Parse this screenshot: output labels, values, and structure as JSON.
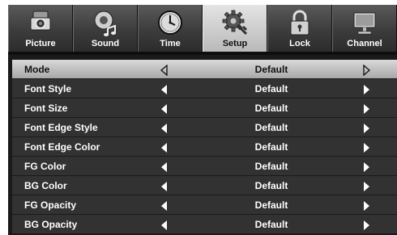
{
  "tabs": [
    {
      "label": "Picture",
      "icon": "picture-camera-icon",
      "active": false
    },
    {
      "label": "Sound",
      "icon": "sound-speaker-icon",
      "active": false
    },
    {
      "label": "Time",
      "icon": "clock-icon",
      "active": false
    },
    {
      "label": "Setup",
      "icon": "setup-gear-icon",
      "active": true
    },
    {
      "label": "Lock",
      "icon": "padlock-icon",
      "active": false
    },
    {
      "label": "Channel",
      "icon": "monitor-icon",
      "active": false
    }
  ],
  "menu": {
    "rows": [
      {
        "label": "Mode",
        "value": "Default",
        "selected": true
      },
      {
        "label": "Font Style",
        "value": "Default",
        "selected": false
      },
      {
        "label": "Font Size",
        "value": "Default",
        "selected": false
      },
      {
        "label": "Font Edge Style",
        "value": "Default",
        "selected": false
      },
      {
        "label": "Font Edge Color",
        "value": "Default",
        "selected": false
      },
      {
        "label": "FG Color",
        "value": "Default",
        "selected": false
      },
      {
        "label": "BG Color",
        "value": "Default",
        "selected": false
      },
      {
        "label": "FG Opacity",
        "value": "Default",
        "selected": false
      },
      {
        "label": "BG Opacity",
        "value": "Default",
        "selected": false
      }
    ]
  },
  "colors": {
    "background": "#1a1a1a",
    "row": "#323232",
    "selected_row": "#c4c4c4",
    "active_tab": "#d0d0d0",
    "text": "#ffffff"
  }
}
